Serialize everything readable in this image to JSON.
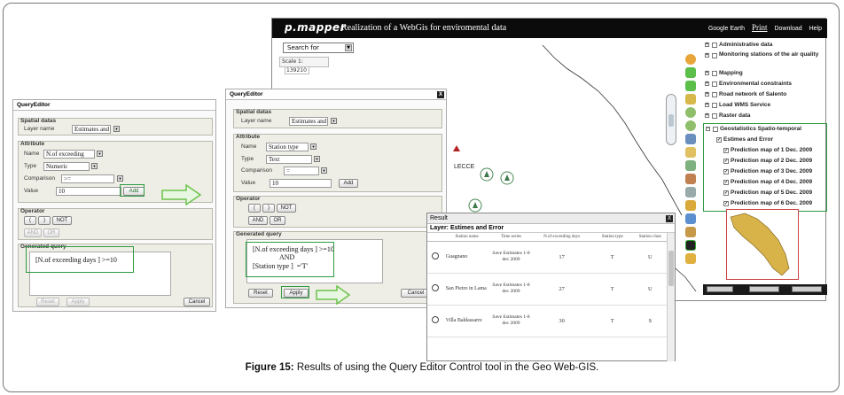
{
  "pmapper": {
    "logo": "p.mapper",
    "title": "Realization of a WebGis for enviromental data",
    "links": {
      "google_earth": "Google Earth",
      "print": "Print",
      "download": "Download",
      "help": "Help"
    },
    "search_select": "Search for",
    "scale_label": "Scale 1:",
    "scale_value": "139210",
    "map_label": "LECCE",
    "legend": {
      "items": [
        "Administrative data",
        "Monitoring stations of the air quality",
        "Mapping",
        "Environmental constraints",
        "Road network of Salento",
        "Load WMS Service",
        "Raster data",
        "Geostatistics Spatio-temporal"
      ],
      "sub_items": [
        "Estimes and Error",
        "Prediction map of 1 Dec. 2009",
        "Prediction map of 2 Dec. 2009",
        "Prediction map of 3 Dec. 2009",
        "Prediction map of 4 Dec. 2009",
        "Prediction map of 5 Dec. 2009",
        "Prediction map of 6 Dec. 2009"
      ]
    }
  },
  "qe1": {
    "title": "QueryEditor",
    "spatial_header": "Spatial datas",
    "layer_label": "Layer name",
    "layer_value": "Estimates and",
    "attribute_header": "Attribute",
    "name_label": "Name",
    "name_value": "N.of exceeding",
    "type_label": "Type",
    "type_value": "Numeric",
    "comparison_label": "Comparison",
    "comparison_value": ">=",
    "value_label": "Value",
    "value_value": "10",
    "add_label": "Add",
    "operator_header": "Operator",
    "op_open": "(",
    "op_close": ")",
    "op_not": "NOT",
    "op_and": "AND",
    "op_or": "OR",
    "generated_header": "Generated query",
    "generated_text": "[N.of exceeding days ] >=10",
    "reset_label": "Reset",
    "apply_label": "Apply",
    "cancel_label": "Cancel"
  },
  "qe2": {
    "title": "QueryEditor",
    "close": "X",
    "spatial_header": "Spatial datas",
    "layer_label": "Layer name",
    "layer_value": "Estimates and",
    "attribute_header": "Attribute",
    "name_label": "Name",
    "name_value": "Station type",
    "type_label": "Type",
    "type_value": "Text",
    "comparison_label": "Comparison",
    "comparison_value": "=",
    "value_label": "Value",
    "value_value": "10",
    "add_label": "Add",
    "operator_header": "Operator",
    "op_open": "(",
    "op_close": ")",
    "op_not": "NOT",
    "op_and": "AND",
    "op_or": "OR",
    "generated_header": "Generated query",
    "generated_line1": "[N.of exceeding days ] >=10",
    "generated_line2": "AND",
    "generated_line3": "[Station type ]  ='T'",
    "reset_label": "Reset",
    "apply_label": "Apply",
    "cancel_label": "Cancel"
  },
  "results": {
    "title": "Result",
    "close": "X",
    "layer": "Layer: Estimes and Error",
    "columns": [
      "Station name",
      "Time series",
      "N.of exceeding days",
      "Station type",
      "Station class"
    ],
    "rows": [
      {
        "name": "Guagnano",
        "time_series": "Save Estimates 1-8 dec 2009",
        "days": "17",
        "type": "T",
        "class": "U"
      },
      {
        "name": "San Pietro in Lama",
        "time_series": "Save Estimates 1-8 dec 2009",
        "days": "27",
        "type": "T",
        "class": "U"
      },
      {
        "name": "Villa Baldassarre",
        "time_series": "Save Estimates 1-8 dec 2009",
        "days": "30",
        "type": "T",
        "class": "S"
      }
    ]
  },
  "caption": {
    "label": "Figure 15:",
    "text": " Results of using the Query Editor Control tool in the Geo Web-GIS."
  },
  "colors": {
    "highlight": "#2e9b42",
    "arrow": "#6cc24a",
    "bar": "#0b0b0b"
  }
}
